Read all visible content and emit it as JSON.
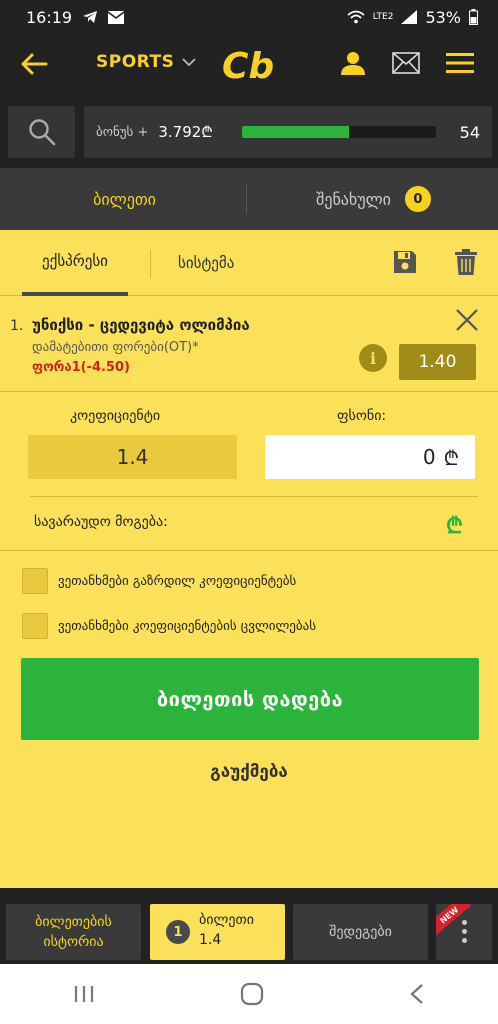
{
  "status_bar": {
    "time": "16:19",
    "battery": "53%",
    "network": "LTE2"
  },
  "header": {
    "sports_label": "SPORTS",
    "logo_text": "Cb"
  },
  "bonus": {
    "label": "ბონუს +",
    "value": "3.792₾",
    "progress": 0.55,
    "count": "54"
  },
  "main_tabs": {
    "ticket": "ბილეთი",
    "saved": "შენახული",
    "saved_count": "0"
  },
  "bet_tabs": {
    "express": "ექსპრესი",
    "system": "სისტემა"
  },
  "bet_item": {
    "index": "1.",
    "title": "უნიქსი - ცედევიტა ოლიმპია",
    "market": "დამატებითი ფორები(OT)*",
    "pick": "ფორა1(-4.50)",
    "odd": "1.40"
  },
  "stake": {
    "coef_label": "კოეფიციენტი",
    "amount_label": "ფსონი:",
    "coef_value": "1.4",
    "amount_value": "0",
    "currency": "₾"
  },
  "winnings": {
    "label": "სავარაუდო მოგება:",
    "currency": "₾"
  },
  "options": {
    "accept_higher": "ვეთანხმები გაზრდილ კოეფიციენტებს",
    "accept_changes": "ვეთანხმები კოეფიციენტების ცვლილებას"
  },
  "actions": {
    "place_bet": "ბილეთის დადება",
    "cancel": "გაუქმება"
  },
  "bottom_nav": {
    "history_line1": "ბილეთების",
    "history_line2": "ისტორია",
    "ticket_count": "1",
    "ticket_label": "ბილეთი",
    "ticket_odd": "1.4",
    "results": "შედეგები",
    "new_badge": "NEW"
  },
  "colors": {
    "accent": "#f7d31e",
    "panel": "#fbe15a",
    "green": "#2bb33c",
    "red": "#d2211e",
    "dark": "#222222"
  }
}
